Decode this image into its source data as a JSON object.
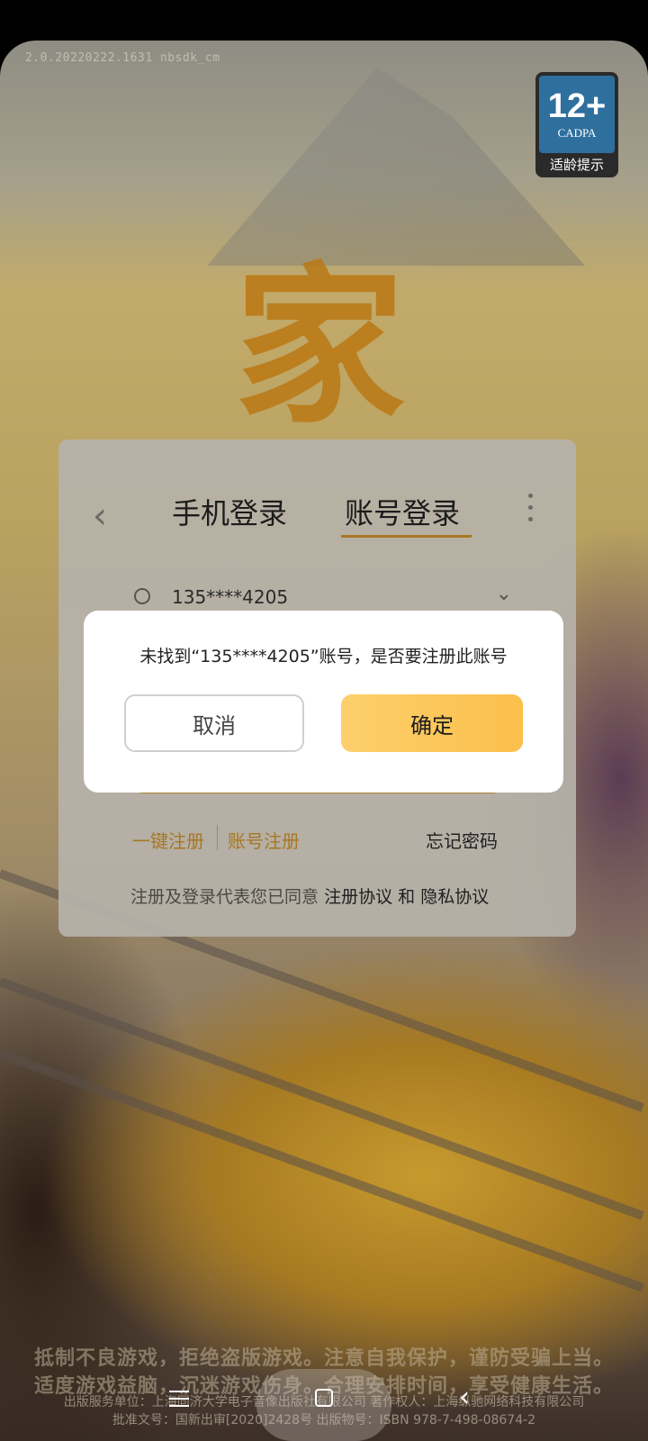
{
  "status": {
    "version": "2.0.20220222.1631 nbsdk_cm"
  },
  "age_badge": {
    "age": "12+",
    "org": "CADPA",
    "tip": "适龄提示"
  },
  "logo": {
    "glyph": "家"
  },
  "login": {
    "tabs": [
      {
        "label": "手机登录",
        "active": false
      },
      {
        "label": "账号登录",
        "active": true
      }
    ],
    "account_value": "135****4205",
    "links": {
      "quick_register": "一键注册",
      "account_register": "账号注册",
      "forgot": "忘记密码"
    },
    "agreement": {
      "prefix": "注册及登录代表您已同意",
      "terms": "注册协议",
      "and": "和",
      "privacy": "隐私协议"
    }
  },
  "dialog": {
    "message": "未找到“135****4205”账号，是否要注册此账号",
    "cancel_label": "取消",
    "confirm_label": "确定"
  },
  "footer": {
    "line1": "抵制不良游戏，拒绝盗版游戏。注意自我保护，谨防受骗上当。",
    "line2": "适度游戏益脑，沉迷游戏伤身。合理安排时间，享受健康生活。",
    "line3": "出版服务单位：上海同济大学电子音像出版社有限公司 著作权人：上海纵驰网络科技有限公司",
    "line4": "批准文号：国新出审[2020]2428号 出版物号：ISBN 978-7-498-08674-2"
  },
  "colors": {
    "accent": "#a77722",
    "confirm": "#fbbf4c",
    "logo": "#ba7814"
  }
}
